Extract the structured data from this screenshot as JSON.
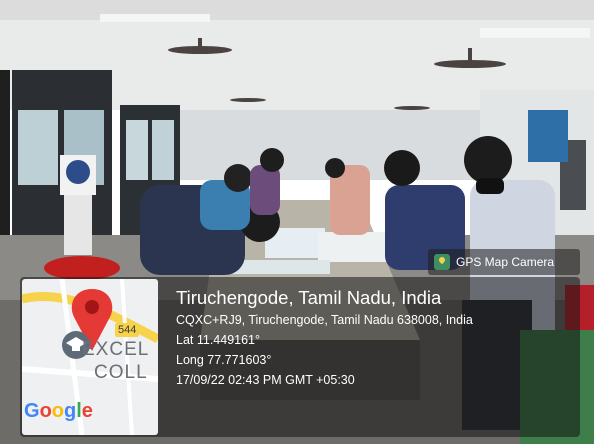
{
  "badge": {
    "label": "GPS Map Camera",
    "icon": "map-pin-icon"
  },
  "location": {
    "title": "Tiruchengode, Tamil Nadu, India",
    "address": "CQXC+RJ9, Tiruchengode, Tamil Nadu 638008, India",
    "lat": "Lat 11.449161°",
    "long": "Long 77.771603°",
    "datetime": "17/09/22 02:43 PM GMT +05:30"
  },
  "map": {
    "road_label": "544",
    "place_line_1": "EXCEL",
    "place_line_2": "COLL",
    "attribution": [
      "G",
      "o",
      "o",
      "g",
      "l",
      "e"
    ],
    "attribution_colors": [
      "#4285F4",
      "#EA4335",
      "#FBBC05",
      "#4285F4",
      "#34A853",
      "#EA4335"
    ],
    "pin_color": "#e53935",
    "school_icon": "graduation-cap-icon"
  },
  "google_logo_text": "Google"
}
